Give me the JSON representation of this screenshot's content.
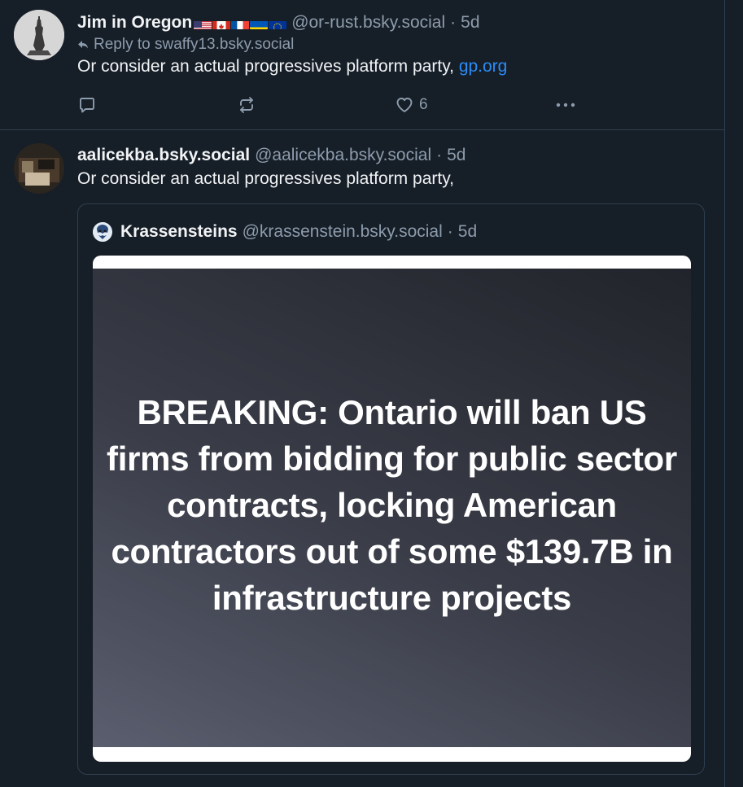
{
  "posts": [
    {
      "author": {
        "display_name": "Jim in Oregon",
        "flags": [
          "us-flag-icon",
          "canada-flag-icon",
          "france-flag-icon",
          "ukraine-flag-icon",
          "eu-flag-icon"
        ],
        "handle": "@or-rust.bsky.social",
        "time": "5d"
      },
      "reply_to": "Reply to swaffy13.bsky.social",
      "text": "Or consider an actual progressives platform party, ",
      "link": "gp.org",
      "actions": {
        "reply_icon": "reply-icon",
        "repost_icon": "repost-icon",
        "like_icon": "heart-icon",
        "like_count": "6",
        "more_icon": "more-icon"
      }
    },
    {
      "author": {
        "display_name": "aalicekba.bsky.social",
        "handle": "@aalicekba.bsky.social",
        "time": "5d"
      },
      "text": "Or consider an actual progressives platform party,",
      "quote": {
        "author": {
          "display_name": "Krassensteins",
          "handle": "@krassenstein.bsky.social",
          "time": "5d"
        },
        "image_text": "BREAKING: Ontario will ban US firms from bidding for public sector contracts, locking American contractors out of some $139.7B in infrastructure projects"
      }
    }
  ],
  "colors": {
    "background": "#161e27",
    "text_primary": "#f1f3f5",
    "text_secondary": "#8d9cad",
    "link": "#2a8cf7",
    "border": "#2e4052"
  },
  "separator": "·"
}
